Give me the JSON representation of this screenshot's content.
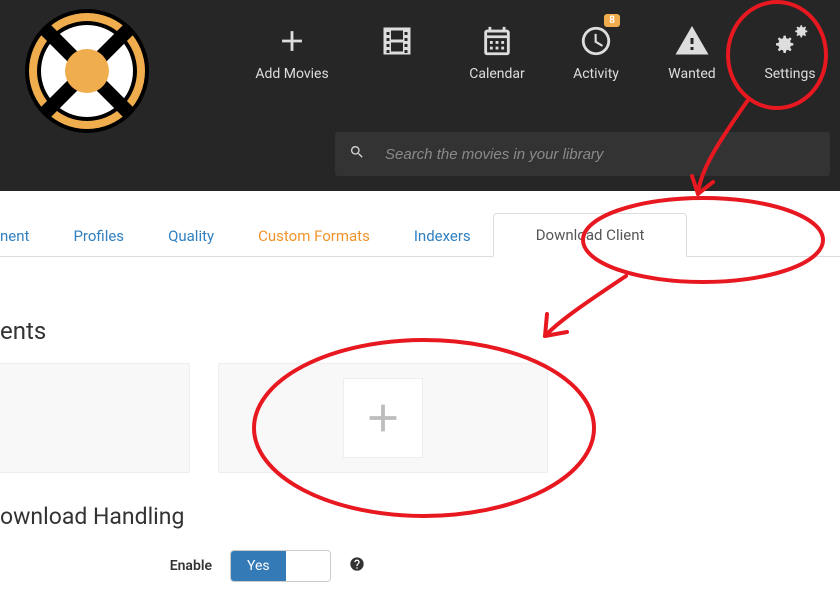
{
  "nav": {
    "items": [
      {
        "label": "Add Movies"
      },
      {
        "label": ""
      },
      {
        "label": "Calendar"
      },
      {
        "label": "Activity",
        "badge": "8"
      },
      {
        "label": "Wanted"
      },
      {
        "label": "Settings"
      }
    ]
  },
  "search": {
    "placeholder": "Search the movies in your library"
  },
  "tabs": {
    "items": [
      {
        "label": "nent"
      },
      {
        "label": "Profiles"
      },
      {
        "label": "Quality"
      },
      {
        "label": "Custom Formats"
      },
      {
        "label": "Indexers"
      },
      {
        "label": "Download Client"
      }
    ]
  },
  "sections": {
    "clients_title": "ents",
    "handling_title": "ownload Handling"
  },
  "form": {
    "enable_label": "Enable",
    "enable_value": "Yes"
  },
  "colors": {
    "accent": "#f0ad4e",
    "link": "#3080c0",
    "primary": "#337ab7",
    "annotation": "#e7181f"
  }
}
